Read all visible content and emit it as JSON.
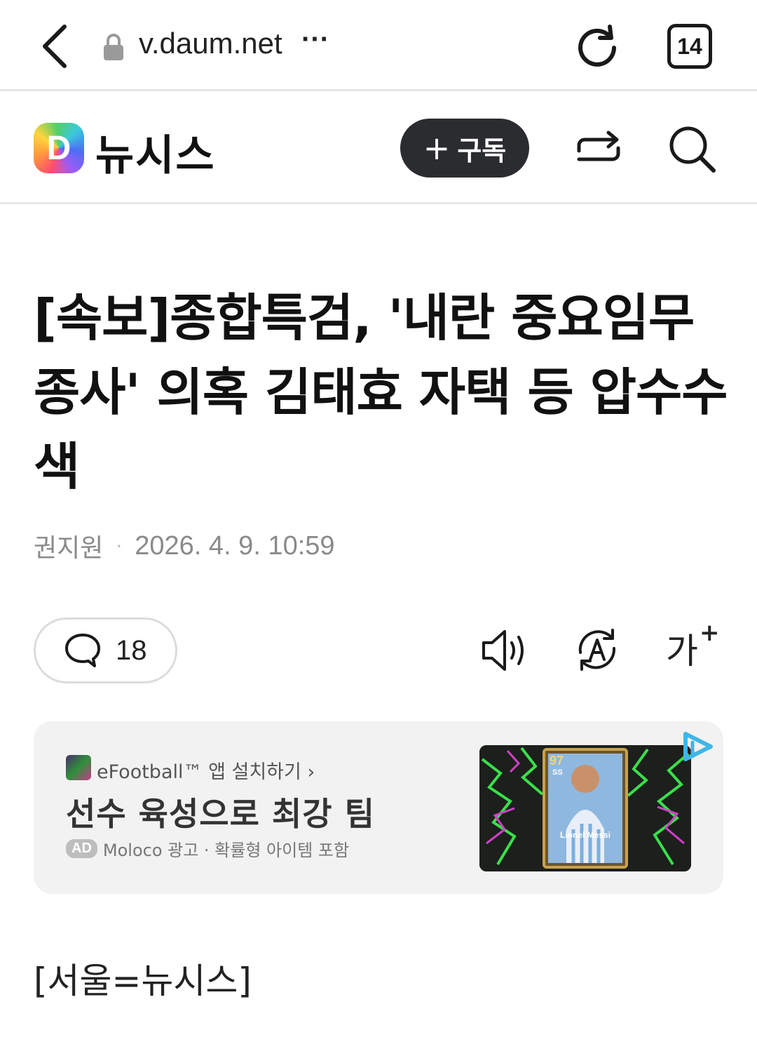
{
  "browser": {
    "url": "v.daum.net",
    "url_more": "···",
    "tab_count": "14"
  },
  "header": {
    "logo_letter": "D",
    "site_name": "뉴시스",
    "subscribe_plus": "+",
    "subscribe_label": "구독"
  },
  "article": {
    "headline": "[속보]종합특검, '내란 중요임무 종사' 의혹 김태효 자택 등 압수수색",
    "author": "권지원",
    "separator": "·",
    "date": "2026. 4. 9. 10:59",
    "comment_count": "18",
    "font_size_label": "가",
    "font_size_plus": "+",
    "dateline": "[서울=뉴시스]"
  },
  "ad": {
    "app_name": "eFootball™ 앱 설치하기 ›",
    "title": "선수 육성으로 최강 팀",
    "badge": "AD",
    "meta": "Moloco 광고 · 확률형 아이템 포함",
    "card_rating": "97",
    "card_position": "SS",
    "card_player": "Lionel Messi"
  },
  "colors": {
    "subscribe_bg": "#2b2c30",
    "ad_bg": "#f2f2f2",
    "ad_choice": "#3fb6e6",
    "meta_gray": "#8a8a8a"
  },
  "icons": [
    "back-icon",
    "lock-icon",
    "reload-icon",
    "tabs-icon",
    "daum-logo",
    "share-icon",
    "search-icon",
    "comment-icon",
    "speaker-icon",
    "translate-icon",
    "font-size-icon",
    "ad-choice-icon"
  ]
}
